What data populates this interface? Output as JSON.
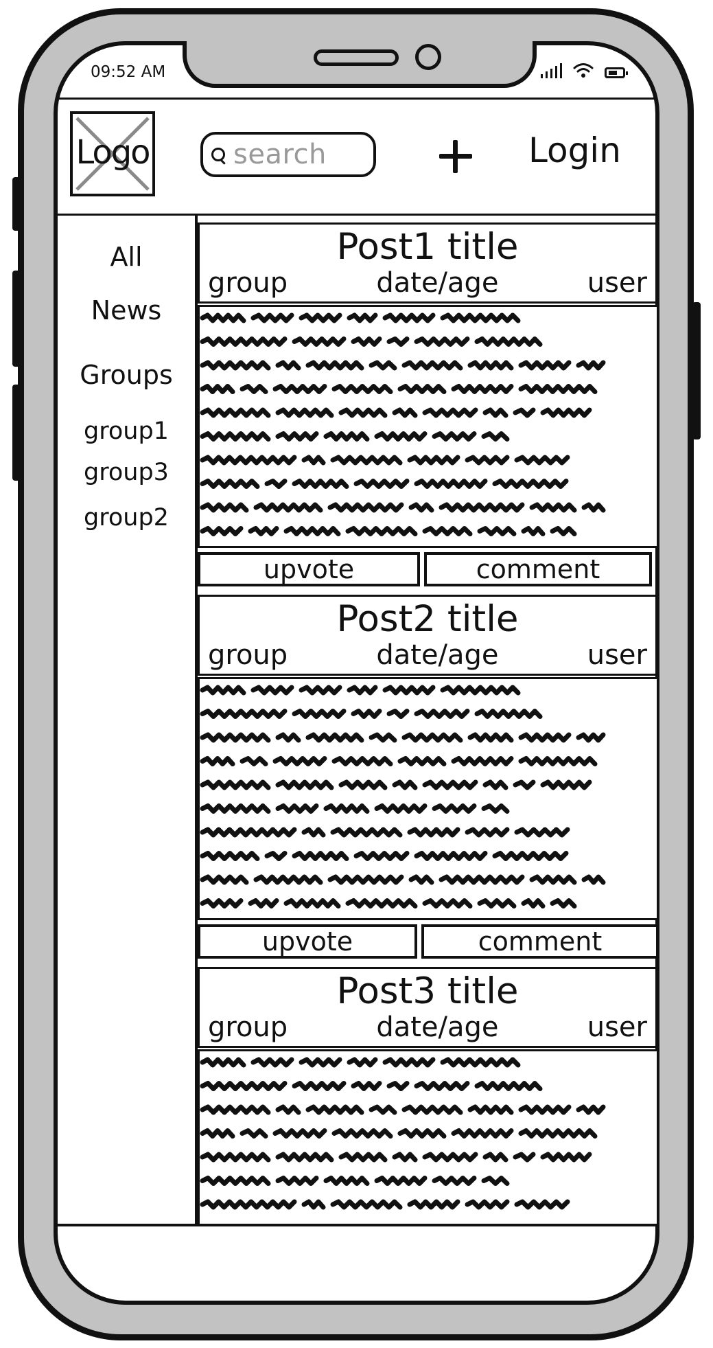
{
  "status_bar": {
    "time": "09:52 AM"
  },
  "header": {
    "logo_text": "Logo",
    "search_placeholder": "search",
    "add_icon": "plus-icon",
    "login_label": "Login"
  },
  "sidebar": {
    "items": [
      {
        "label": "All"
      },
      {
        "label": "News"
      },
      {
        "label": "Groups"
      },
      {
        "label": "group1"
      },
      {
        "label": "group3"
      },
      {
        "label": "group2"
      }
    ]
  },
  "posts": [
    {
      "title": "Post1 title",
      "group": "group",
      "date": "date/age",
      "user": "user",
      "upvote_label": "upvote",
      "comment_label": "comment"
    },
    {
      "title": "Post2 title",
      "group": "group",
      "date": "date/age",
      "user": "user",
      "upvote_label": "upvote",
      "comment_label": "comment"
    },
    {
      "title": "Post3 title",
      "group": "group",
      "date": "date/age",
      "user": "user"
    }
  ]
}
